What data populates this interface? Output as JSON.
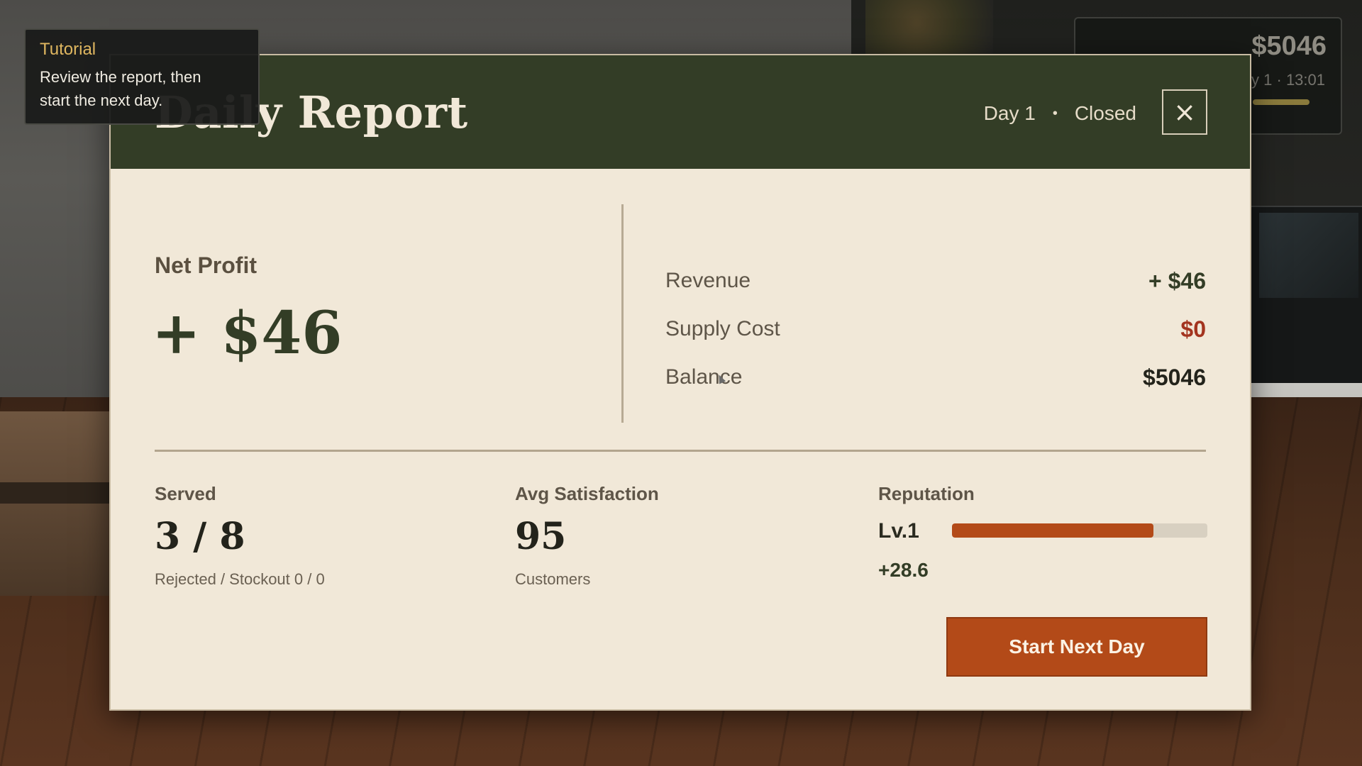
{
  "hud": {
    "money": "$5046",
    "time_text": "ay 1 · 13:01"
  },
  "tutorial": {
    "title": "Tutorial",
    "body_line1": "Review the report, then",
    "body_line2": "start the next day."
  },
  "report": {
    "title": "Daily Report",
    "day": "Day 1",
    "separator": "•",
    "status": "Closed",
    "close_icon": "×",
    "net_profit_label": "Net Profit",
    "net_profit_value": "+ $46",
    "rows": [
      {
        "label": "Revenue",
        "value": "+ $46"
      },
      {
        "label": "Supply Cost",
        "value": "$0"
      },
      {
        "label": "Balance",
        "value": "$5046"
      }
    ],
    "served": {
      "label": "Served",
      "value": "3 / 8",
      "sub": "Rejected / Stockout  0 / 0"
    },
    "satisfaction": {
      "label": "Avg Satisfaction",
      "value": "95",
      "sub": "Customers"
    },
    "reputation": {
      "label": "Reputation",
      "level": "Lv.1",
      "progress": 0.79,
      "delta": "+28.6"
    },
    "start_button": "Start Next Day"
  },
  "colors": {
    "header": "#333d26",
    "panel": "#f1e8d8",
    "accent": "#b34a18",
    "negative": "#a3341f"
  }
}
